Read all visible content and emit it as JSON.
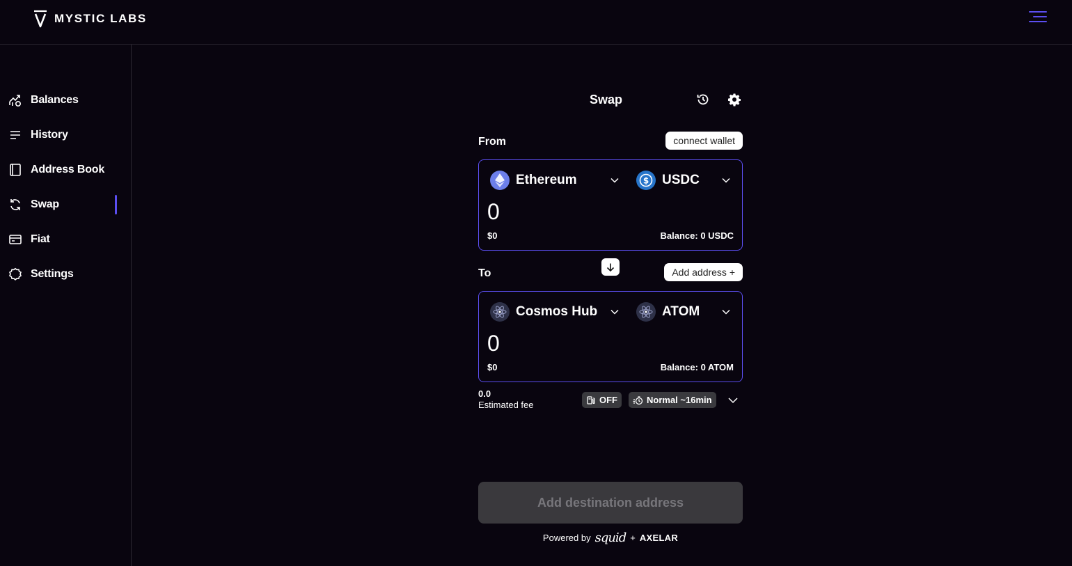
{
  "brand": {
    "name": "MYSTIC LABS",
    "accent": "#5b4ef0"
  },
  "header": {
    "menu_icon": "hamburger-menu-icon"
  },
  "sidebar": {
    "items": [
      {
        "label": "Balances",
        "icon": "chart-coins-icon"
      },
      {
        "label": "History",
        "icon": "lines-icon"
      },
      {
        "label": "Address Book",
        "icon": "book-icon"
      },
      {
        "label": "Swap",
        "icon": "swap-arrows-icon",
        "active": true
      },
      {
        "label": "Fiat",
        "icon": "card-icon"
      },
      {
        "label": "Settings",
        "icon": "gear-outline-icon"
      }
    ]
  },
  "swap": {
    "title": "Swap",
    "from": {
      "label": "From",
      "action": "connect wallet",
      "chain": "Ethereum",
      "asset": "USDC",
      "amount": "0",
      "usd": "$0",
      "balance": "Balance: 0 USDC"
    },
    "to": {
      "label": "To",
      "action": "Add address +",
      "chain": "Cosmos Hub",
      "asset": "ATOM",
      "amount": "0",
      "usd": "$0",
      "balance": "Balance: 0 ATOM"
    },
    "fee": {
      "value": "0.0",
      "label": "Estimated fee"
    },
    "gas_chip": "OFF",
    "speed_chip": "Normal ~16min",
    "submit": "Add destination address",
    "powered": {
      "prefix": "Powered by",
      "joiner": "+",
      "partner_a": "squid",
      "partner_b": "AXELAR"
    }
  }
}
